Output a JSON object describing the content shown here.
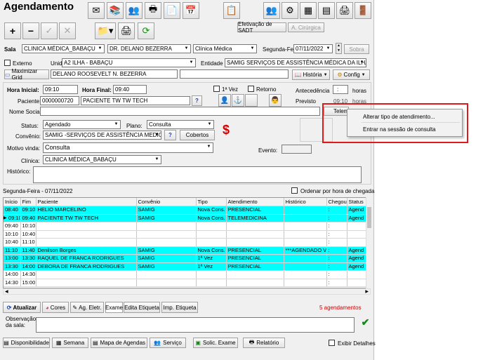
{
  "window": {
    "title": "Agendamento"
  },
  "toolbar": {
    "add": "+",
    "remove": "−",
    "confirm": "✓",
    "cancel": "✕",
    "efetivacao_sadt": "Efetivação de SADT",
    "cirurgica": "A. Cirúrgica"
  },
  "filters": {
    "sala_label": "Sala",
    "sala": "CLINICA MÉDICA_BABAÇU",
    "medico": "DR. DELANO BEZERRA",
    "especialidade": "Clínica Médica",
    "dia_label": "Segunda-Feir",
    "data": "07/11/2022",
    "sobra": "Sobra",
    "externo_label": "Externo",
    "unidade_label": "Unidade:",
    "unidade": "A2 ILHA - BABAÇU",
    "entidade_label": "Entidade",
    "entidade": "SAMIG SERVIÇOS DE ASSISTÊNCIA MÉDICA DA ILHA LTDA",
    "maximizar_grid": "Maximizar Grid",
    "medico_nome": "DELANO ROOSEVELT N. BEZERRA",
    "historia": "História",
    "config": "Config"
  },
  "form": {
    "hora_inicial_label": "Hora Inicial:",
    "hora_inicial": "09:10",
    "hora_final_label": "Hora Final:",
    "hora_final": "09:40",
    "primeira_vez": "1ª Vez",
    "retorno": "Retorno",
    "antecedencia_label": "Antecedência",
    "antecedencia_unit": "horas",
    "paciente_label": "Paciente:",
    "paciente_codigo": "0000000720",
    "paciente_nome": "PACIENTE TW TW TECH",
    "previsto_label": "Previsto",
    "previsto_val": "09:10",
    "previsto_unit": "horas",
    "nome_social_label": "Nome Social:",
    "tele_btn": "Teleme",
    "status_label": "Status:",
    "status": "Agendado",
    "plano_label": "Plano:",
    "plano": "Consulta",
    "convenio_label": "Convênio:",
    "convenio": "SAMIG -SERVIÇOS DE ASSISTÊNCIA MEDICA",
    "cobertos": "Cobertos",
    "help": "?",
    "motivo_label": "Motivo vinda:",
    "motivo": "Consulta",
    "evento_label": "Evento:",
    "clinica_label": "Clínica:",
    "clinica": "CLINICA MÉDICA_BABAÇU",
    "historico_label": "Histórico:"
  },
  "context_menu": {
    "items": [
      "Alterar tipo de atendimento...",
      "Entrar na sessão de consulta"
    ]
  },
  "grid": {
    "day_label": "Segunda-Feira - 07/11/2022",
    "ordenar_label": "Ordenar por hora de chegada",
    "columns": [
      "Início",
      "Fim",
      "Paciente",
      "Convênio",
      "Tipo",
      "Atendimento",
      "Histórico",
      "Chegou",
      "Status"
    ],
    "rows": [
      {
        "c": [
          "08:40",
          "09:10",
          "HELIO MARCELINO",
          "SAMIG",
          "Nova Cons.",
          "PRESENCIAL",
          "",
          ":",
          "Agend"
        ],
        "hl": true,
        "cur": false
      },
      {
        "c": [
          "09:10",
          "09:40",
          "PACIENTE TW TW TECH",
          "SAMIG",
          "Nova Cons.",
          "TELEMEDICINA",
          "",
          ":",
          "Agend"
        ],
        "hl": true,
        "cur": true
      },
      {
        "c": [
          "09:40",
          "10:10",
          "",
          "",
          "",
          "",
          "",
          ":",
          ""
        ],
        "hl": false,
        "cur": false
      },
      {
        "c": [
          "10:10",
          "10:40",
          "",
          "",
          "",
          "",
          "",
          ":",
          ""
        ],
        "hl": false,
        "cur": false
      },
      {
        "c": [
          "10:40",
          "11:10",
          "",
          "",
          "",
          "",
          "",
          ":",
          ""
        ],
        "hl": false,
        "cur": false
      },
      {
        "c": [
          "11:10",
          "11:40",
          "Denilson  Borges",
          "SAMIG",
          "Nova Cons.",
          "PRESENCIAL",
          "***AGENDADO VI",
          ":",
          "Agend"
        ],
        "hl": true,
        "cur": false
      },
      {
        "c": [
          "13:00",
          "13:30",
          "RAQUEL DE FRANCA RODRIGUES",
          "SAMIG",
          "1ª Vez",
          "PRESENCIAL",
          "",
          ":",
          "Agend"
        ],
        "hl": true,
        "cur": false
      },
      {
        "c": [
          "13:30",
          "14:00",
          "DEBORA DE FRANCA RODRIGUES",
          "SAMIG",
          "1ª Vez",
          "PRESENCIAL",
          "",
          ":",
          "Agend"
        ],
        "hl": true,
        "cur": false
      },
      {
        "c": [
          "14:00",
          "14:30",
          "",
          "",
          "",
          "",
          "",
          ":",
          ""
        ],
        "hl": false,
        "cur": false
      },
      {
        "c": [
          "14:30",
          "15:00",
          "",
          "",
          "",
          "",
          "",
          ":",
          ""
        ],
        "hl": false,
        "cur": false
      }
    ]
  },
  "bottom": {
    "atualizar": "Atualizar",
    "cores": "Cores",
    "ag_eletr": "Ag. Eletr.",
    "exame": "Exame",
    "edita_etiqueta": "Edita Etiqueta",
    "imp_etiqueta": "Imp. Etiqueta",
    "agendamentos": "5 agendamentos",
    "obs_label": "Observação da sala:",
    "disponibilidade": "Disponibilidade",
    "semana": "Semana",
    "mapa": "Mapa de Agendas",
    "servico": "Serviço",
    "solic_exame": "Solic. Exame",
    "relatorio": "Relatório",
    "exibir_detalhes": "Exibir Detalhes"
  },
  "colors": {
    "highlight": "#00ffff",
    "red_box": "#e0191b",
    "count_red": "#cc0000"
  }
}
